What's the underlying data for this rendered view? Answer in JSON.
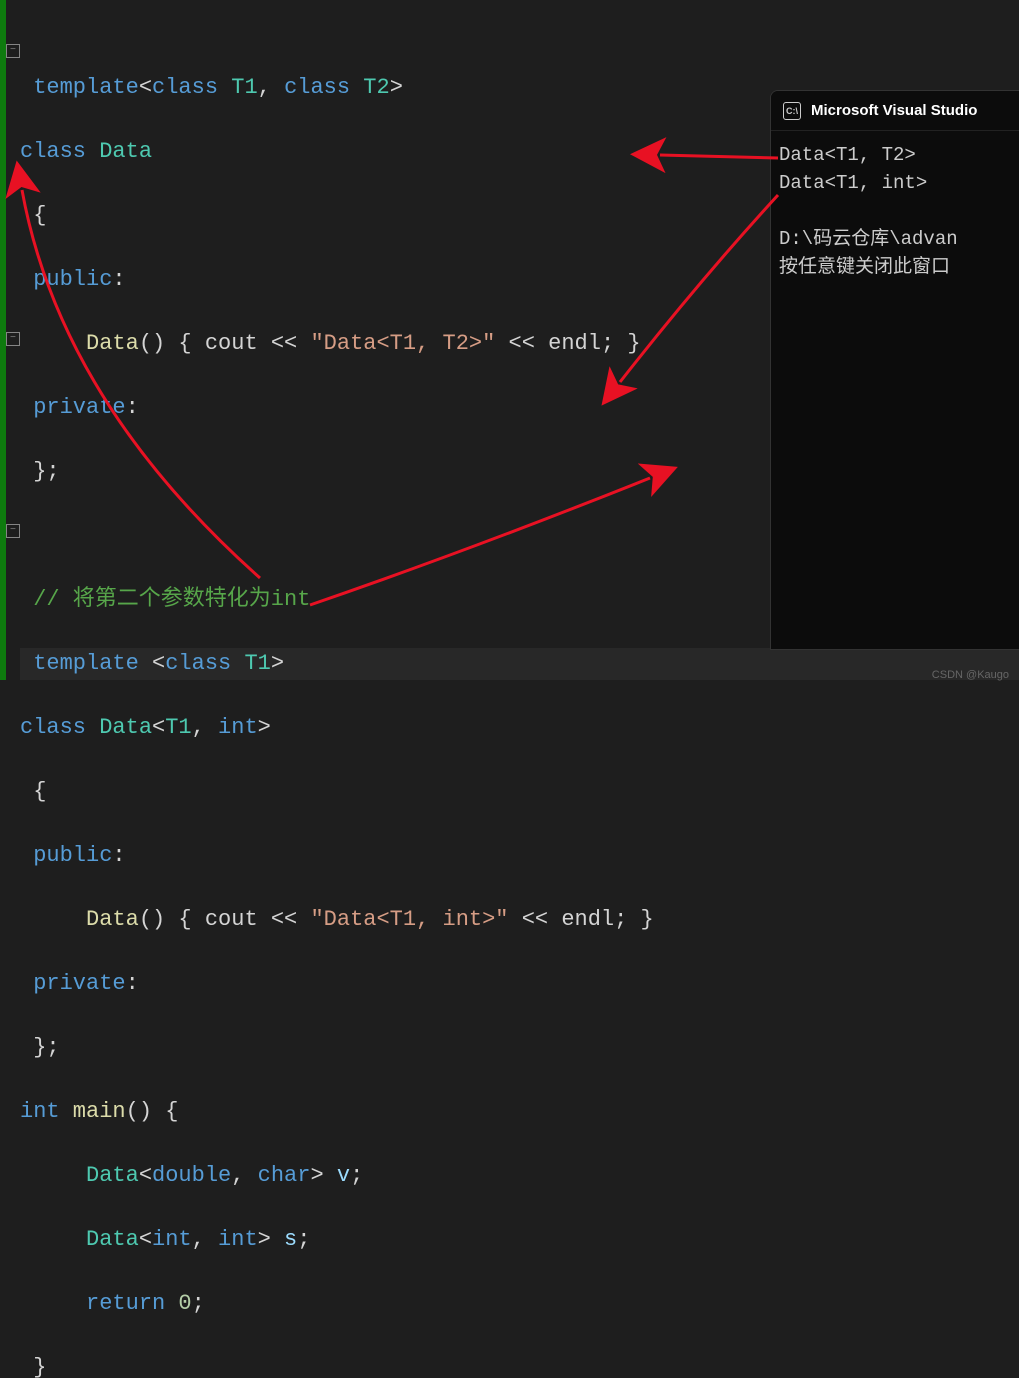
{
  "code": {
    "l1": {
      "template": "template",
      "open": "<",
      "class": "class",
      "t1": " T1",
      "comma": ",",
      "t2": " T2",
      "close": ">"
    },
    "l2": {
      "class": "class",
      "name": " Data"
    },
    "l3": "{",
    "l4": {
      "public": "public",
      "colon": ":"
    },
    "l5": {
      "ctor": "Data",
      "parens": "()",
      "open": " { ",
      "cout": "cout",
      "shl": " << ",
      "str": "\"Data<T1, T2>\"",
      "shl2": " << ",
      "endl": "endl",
      "semi": "; ",
      "close": "}"
    },
    "l6": {
      "private": "private",
      "colon": ":"
    },
    "l7": "};",
    "l8": "",
    "l9": "// 将第二个参数特化为int",
    "l10": {
      "template": "template",
      "open": " <",
      "class": "class",
      "t1": " T1",
      "close": ">"
    },
    "l11": {
      "class": "class",
      "name": " Data",
      "open": "<",
      "t1": "T1",
      "comma": ",",
      "int": " int",
      "close": ">"
    },
    "l12": "{",
    "l13": {
      "public": "public",
      "colon": ":"
    },
    "l14": {
      "ctor": "Data",
      "parens": "()",
      "open": " { ",
      "cout": "cout",
      "shl": " << ",
      "str": "\"Data<T1, int>\"",
      "shl2": " << ",
      "endl": "endl",
      "semi": "; ",
      "close": "}"
    },
    "l15": {
      "private": "private",
      "colon": ":"
    },
    "l16": "};",
    "l17": {
      "int": "int",
      "main": " main",
      "parens": "()",
      "open": " {"
    },
    "l18": {
      "name": "Data",
      "open": "<",
      "double": "double",
      "comma": ",",
      "char": " char",
      "close": ">",
      "var": " v",
      "semi": ";"
    },
    "l19": {
      "name": "Data",
      "open": "<",
      "int": "int",
      "comma": ",",
      "int2": " int",
      "close": ">",
      "var": " s",
      "semi": ";"
    },
    "l20": {
      "return": "return",
      "num": " 0",
      "semi": ";"
    },
    "l21": "}"
  },
  "console": {
    "title": "Microsoft Visual Studio",
    "out1": "Data<T1, T2>",
    "out2": "Data<T1, int>",
    "out3": "",
    "out4": "D:\\码云仓库\\advan",
    "out5": "按任意键关闭此窗口"
  },
  "watermark": "CSDN @Kaugo"
}
